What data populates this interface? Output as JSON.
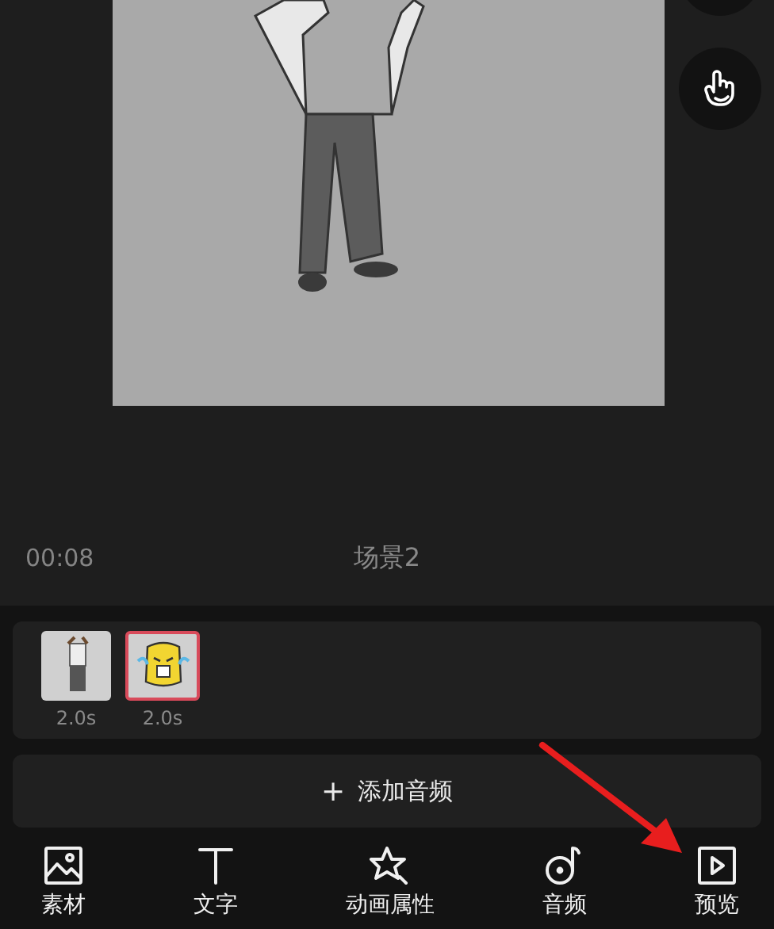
{
  "preview": {
    "time": "00:08",
    "scene_title": "场景2"
  },
  "clips": [
    {
      "kind": "photo",
      "duration": "2.0s",
      "selected": false
    },
    {
      "kind": "sticker",
      "duration": "2.0s",
      "selected": true
    }
  ],
  "add_audio": {
    "icon": "+",
    "label": "添加音频"
  },
  "toolbar": [
    {
      "kind": "image",
      "label": "素材"
    },
    {
      "kind": "text",
      "label": "文字"
    },
    {
      "kind": "star",
      "label": "动画属性"
    },
    {
      "kind": "music",
      "label": "音频"
    },
    {
      "kind": "play",
      "label": "预览"
    }
  ]
}
